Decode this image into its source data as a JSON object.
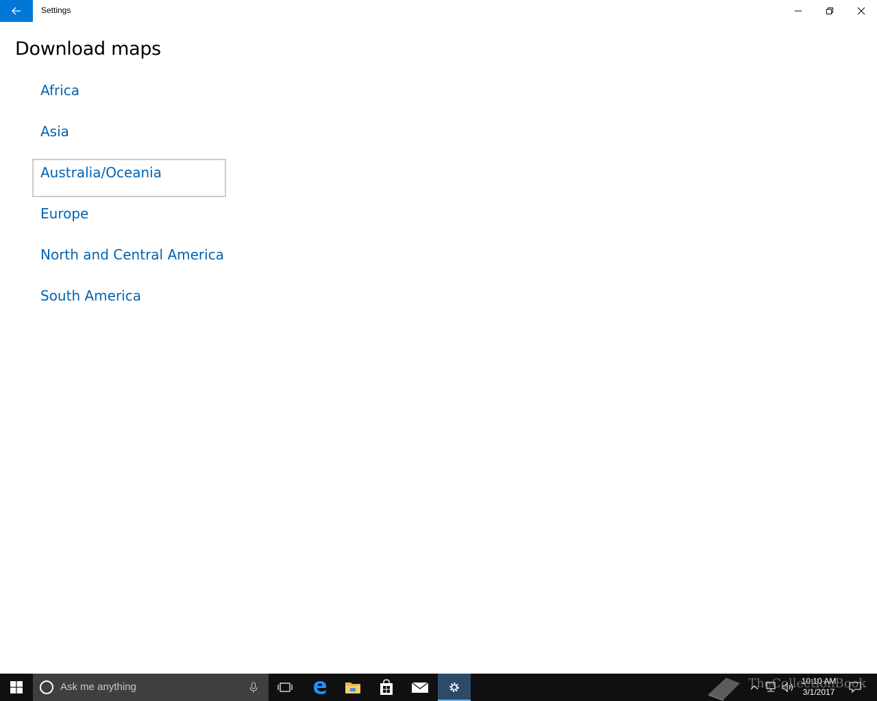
{
  "window": {
    "title": "Settings"
  },
  "page": {
    "title": "Download maps"
  },
  "regions": [
    {
      "label": "Africa"
    },
    {
      "label": "Asia"
    },
    {
      "label": "Australia/Oceania"
    },
    {
      "label": "Europe"
    },
    {
      "label": "North and Central America"
    },
    {
      "label": "South America"
    }
  ],
  "focused_region": "Australia/Oceania",
  "taskbar": {
    "search_placeholder": "Ask me anything",
    "clock_time": "10:10 AM",
    "clock_date": "3/1/2017",
    "pinned": [
      "task-view",
      "edge",
      "file-explorer",
      "store",
      "mail",
      "settings"
    ]
  },
  "watermark": {
    "text": "TheCollectionBook"
  },
  "colors": {
    "accent": "#0078d7",
    "link": "#0063b1",
    "taskbar": "#101010",
    "search_box": "#3f3f3f"
  }
}
